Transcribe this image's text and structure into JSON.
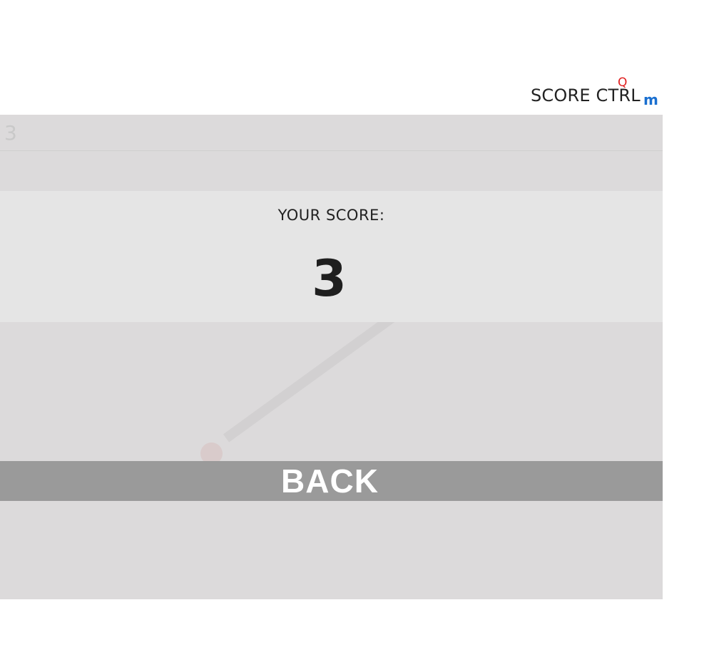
{
  "brand": {
    "text": "SCORE CTRL",
    "accent_top": "Q",
    "accent_sub": "m",
    "accent_top_color": "#e02020",
    "accent_sub_color": "#1a6fd0"
  },
  "hud": {
    "score": "3"
  },
  "result": {
    "label": "YOUR SCORE:",
    "score": "3"
  },
  "back_button": {
    "label": "BACK"
  },
  "colors": {
    "game_background": "#dcdadb",
    "score_panel": "#e5e5e5",
    "back_button": "#9a9a9a"
  }
}
